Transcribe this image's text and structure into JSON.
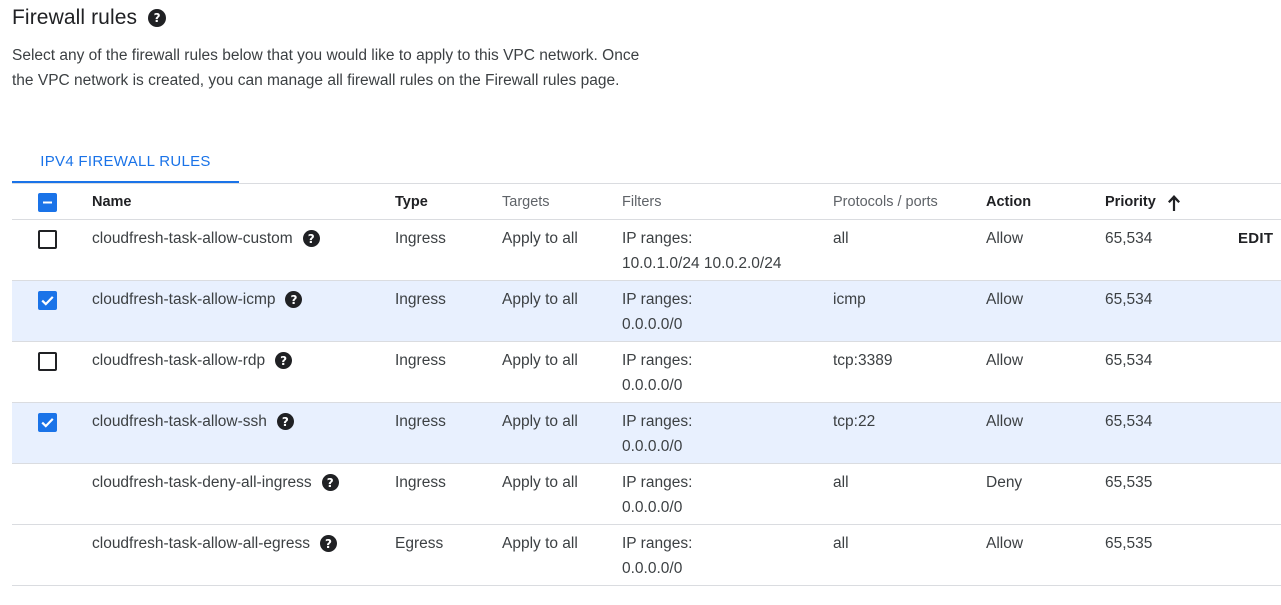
{
  "header": {
    "title": "Firewall rules",
    "help_icon": "help-circle-icon",
    "description": "Select any of the firewall rules below that you would like to apply to this VPC network. Once the VPC network is created, you can manage all firewall rules on the Firewall rules page."
  },
  "tabs": [
    {
      "label": "IPV4 FIREWALL RULES",
      "active": true
    }
  ],
  "table": {
    "columns": {
      "name": "Name",
      "type": "Type",
      "targets": "Targets",
      "filters": "Filters",
      "protocols": "Protocols / ports",
      "action": "Action",
      "priority": "Priority"
    },
    "sort": {
      "column": "priority",
      "direction": "ascending",
      "icon": "arrow-up-icon"
    },
    "select_all_state": "indeterminate",
    "edit_label": "EDIT",
    "rows": [
      {
        "selectable": true,
        "checked": false,
        "name": "cloudfresh-task-allow-custom",
        "type": "Ingress",
        "targets": "Apply to all",
        "filters_label": "IP ranges:",
        "filters_value": "10.0.1.0/24 10.0.2.0/24",
        "protocols": "all",
        "action": "Allow",
        "priority": "65,534",
        "has_edit": true
      },
      {
        "selectable": true,
        "checked": true,
        "name": "cloudfresh-task-allow-icmp",
        "type": "Ingress",
        "targets": "Apply to all",
        "filters_label": "IP ranges:",
        "filters_value": "0.0.0.0/0",
        "protocols": "icmp",
        "action": "Allow",
        "priority": "65,534",
        "has_edit": false
      },
      {
        "selectable": true,
        "checked": false,
        "name": "cloudfresh-task-allow-rdp",
        "type": "Ingress",
        "targets": "Apply to all",
        "filters_label": "IP ranges:",
        "filters_value": "0.0.0.0/0",
        "protocols": "tcp:3389",
        "action": "Allow",
        "priority": "65,534",
        "has_edit": false
      },
      {
        "selectable": true,
        "checked": true,
        "name": "cloudfresh-task-allow-ssh",
        "type": "Ingress",
        "targets": "Apply to all",
        "filters_label": "IP ranges:",
        "filters_value": "0.0.0.0/0",
        "protocols": "tcp:22",
        "action": "Allow",
        "priority": "65,534",
        "has_edit": false
      },
      {
        "selectable": false,
        "checked": false,
        "name": "cloudfresh-task-deny-all-ingress",
        "type": "Ingress",
        "targets": "Apply to all",
        "filters_label": "IP ranges:",
        "filters_value": "0.0.0.0/0",
        "protocols": "all",
        "action": "Deny",
        "priority": "65,535",
        "has_edit": false
      },
      {
        "selectable": false,
        "checked": false,
        "name": "cloudfresh-task-allow-all-egress",
        "type": "Egress",
        "targets": "Apply to all",
        "filters_label": "IP ranges:",
        "filters_value": "0.0.0.0/0",
        "protocols": "all",
        "action": "Allow",
        "priority": "65,535",
        "has_edit": false
      }
    ]
  },
  "colors": {
    "accent": "#1a73e8",
    "selected_row": "#e8f0fe",
    "divider": "#dadce0"
  }
}
